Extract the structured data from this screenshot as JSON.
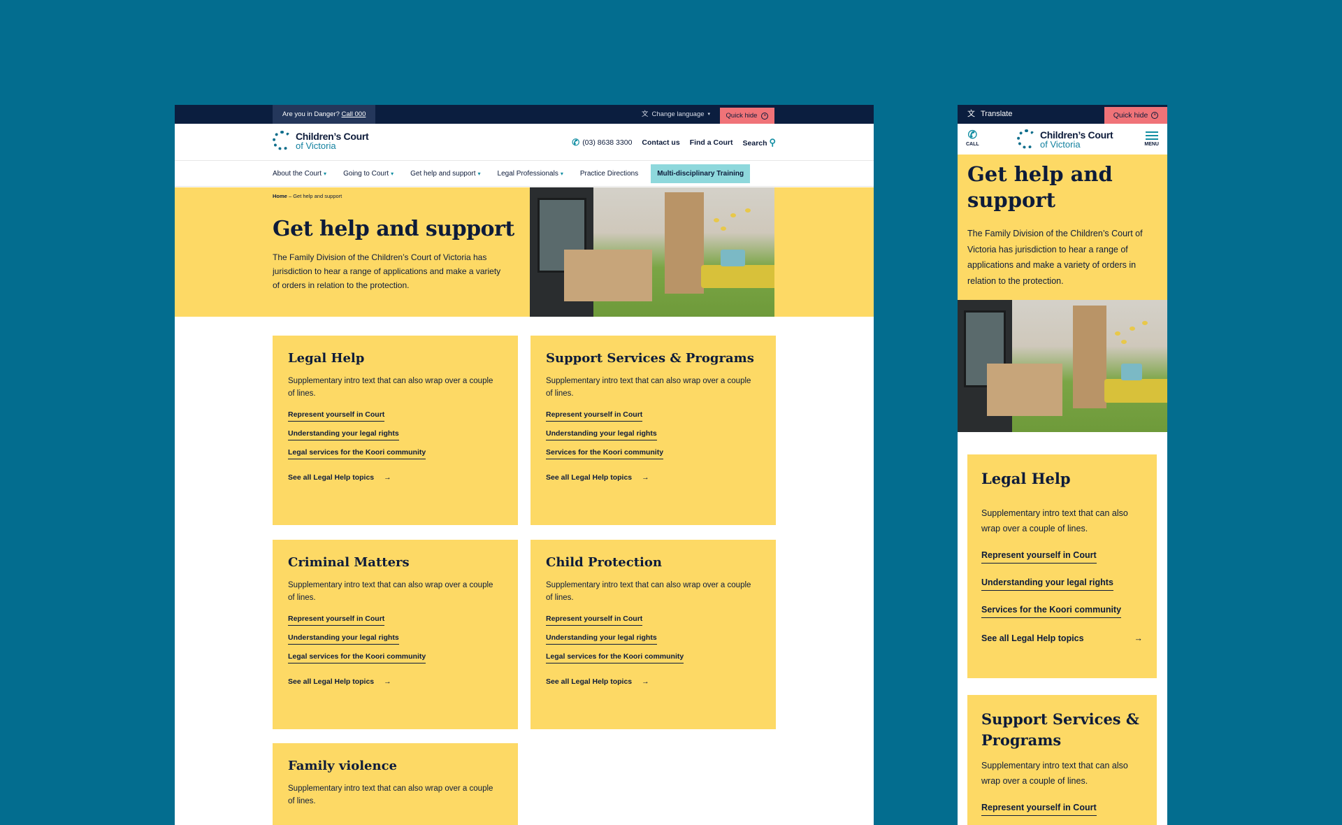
{
  "desktop": {
    "topbar": {
      "danger_text": "Are you in Danger?",
      "danger_call": "Call 000",
      "change_language": "Change language",
      "quick_hide": "Quick hide"
    },
    "logo": {
      "line1": "Children’s Court",
      "line2": "of Victoria"
    },
    "header_links": {
      "phone": "(03) 8638 3300",
      "contact": "Contact us",
      "find": "Find a Court",
      "search": "Search"
    },
    "nav": [
      {
        "label": "About the Court",
        "dropdown": true
      },
      {
        "label": "Going to Court",
        "dropdown": true
      },
      {
        "label": "Get help and support",
        "dropdown": true
      },
      {
        "label": "Legal Professionals",
        "dropdown": true
      },
      {
        "label": "Practice Directions",
        "dropdown": false
      }
    ],
    "nav_highlight": "Multi-disciplinary Training",
    "breadcrumb": {
      "home": "Home",
      "sep": "–",
      "current": "Get help and support"
    },
    "hero": {
      "title": "Get help and support",
      "text": "The Family Division of the Children’s Court of Victoria has jurisdiction to hear a range of applications and make a variety of orders in relation to the protection."
    },
    "cards": [
      {
        "title": "Legal Help",
        "intro": "Supplementary intro text that can also wrap over a couple of lines.",
        "links": [
          "Represent yourself in Court",
          "Understanding your legal rights",
          "Legal services for the Koori community"
        ],
        "see_all": "See all Legal Help topics"
      },
      {
        "title": "Support Services & Programs",
        "intro": "Supplementary intro text that can also wrap over a couple of lines.",
        "links": [
          "Represent yourself in Court",
          "Understanding your legal rights",
          "Services for the Koori community"
        ],
        "see_all": "See all Legal Help topics"
      },
      {
        "title": "Criminal Matters",
        "intro": "Supplementary intro text that can also wrap over a couple of lines.",
        "links": [
          "Represent yourself in Court",
          "Understanding your legal rights",
          "Legal services for the Koori community"
        ],
        "see_all": "See all Legal Help topics"
      },
      {
        "title": "Child Protection",
        "intro": "Supplementary intro text that can also wrap over a couple of lines.",
        "links": [
          "Represent yourself in Court",
          "Understanding your legal rights",
          "Legal services for the Koori community"
        ],
        "see_all": "See all Legal Help topics"
      },
      {
        "title": "Family violence",
        "intro": "Supplementary intro text that can also wrap over a couple of lines."
      }
    ]
  },
  "mobile": {
    "translate": "Translate",
    "quick_hide": "Quick hide",
    "call": "CALL",
    "menu": "MENU",
    "logo": {
      "line1": "Children’s Court",
      "line2": "of Victoria"
    },
    "hero": {
      "title": "Get help and support",
      "text": "The Family Division of the Children’s Court of Victoria has jurisdiction to hear a range of applications and make a variety of orders in relation to the protection."
    },
    "cards": [
      {
        "title": "Legal Help",
        "intro": "Supplementary intro text that can also wrap over a couple of lines.",
        "links": [
          "Represent yourself in Court",
          "Understanding your legal rights",
          "Services for the Koori community"
        ],
        "see_all": "See all Legal Help topics"
      },
      {
        "title": "Support Services & Programs",
        "intro": "Supplementary intro text that can also wrap over a couple of lines.",
        "links": [
          "Represent yourself in Court"
        ]
      }
    ]
  },
  "colors": {
    "background": "#036d8f",
    "navy": "#0b1e3f",
    "yellow": "#fdd965",
    "quick_hide": "#f07378",
    "teal": "#138ea3",
    "training": "#8ed8dc"
  },
  "icons": {
    "translate": "translate-icon",
    "close": "close-circle-icon",
    "phone": "phone-icon",
    "search": "search-icon",
    "arrow": "arrow-right-icon",
    "menu": "menu-icon"
  }
}
